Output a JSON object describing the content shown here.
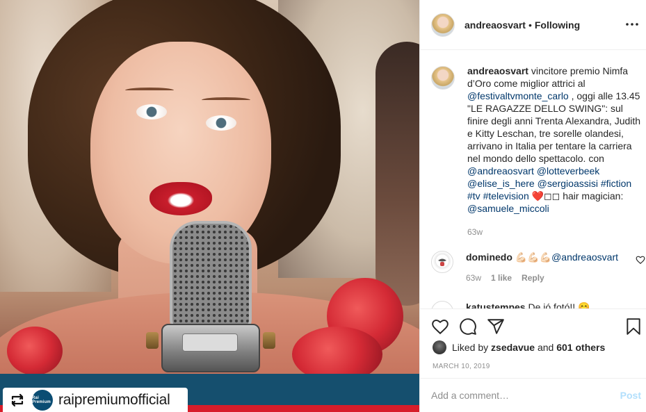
{
  "media": {
    "repost_name": "raipremiumofficial",
    "logo_text": "Rai Premium"
  },
  "post": {
    "author": "andreaosvart",
    "separator": "•",
    "follow_status": "Following",
    "more_icon": "more-horizontal-icon",
    "caption": {
      "author": "andreaosvart",
      "text_1": " vincitore premio Nimfa d’Oro come miglior attrici al ",
      "mention_1": "@festivaltvmonte_carlo",
      "text_2": " , oggi alle 13.45 \"LE RAGAZZE DELLO SWING\": sul finire degli anni Trenta Alexandra, Judith e Kitty Leschan, tre sorelle olandesi, arrivano in Italia per tentare la carriera nel mondo dello spettacolo. con ",
      "mention_2": "@andreaosvart",
      "mention_3": "@lotteverbeek",
      "mention_4": "@elise_is_here",
      "mention_5": "@sergioassisi",
      "tag_1": "#fiction",
      "tag_2": "#tv",
      "tag_3": "#television",
      "emoji": "❤️◻◻",
      "text_3": " hair magician: ",
      "mention_6": "@samuele_miccoli",
      "time": "63w"
    },
    "comments": [
      {
        "user": "dominedo",
        "emoji": "💪🏻💪🏻💪🏻",
        "mention": "@andreaosvart",
        "time": "63w",
        "likes": "1 like",
        "reply": "Reply"
      },
      {
        "user": "katustempes",
        "text": "De jó fotó!! 😊"
      }
    ],
    "liked_by_prefix": "Liked by ",
    "liked_by_user": "zsedavue",
    "liked_by_and": " and ",
    "liked_by_others": "601 others",
    "date": "MARCH 10, 2019",
    "add_comment_placeholder": "Add a comment…",
    "post_label": "Post"
  },
  "colors": {
    "link": "#00376b",
    "muted": "#8e8e8e",
    "post_disabled": "#b2dffc",
    "heart": "#ed4956"
  }
}
